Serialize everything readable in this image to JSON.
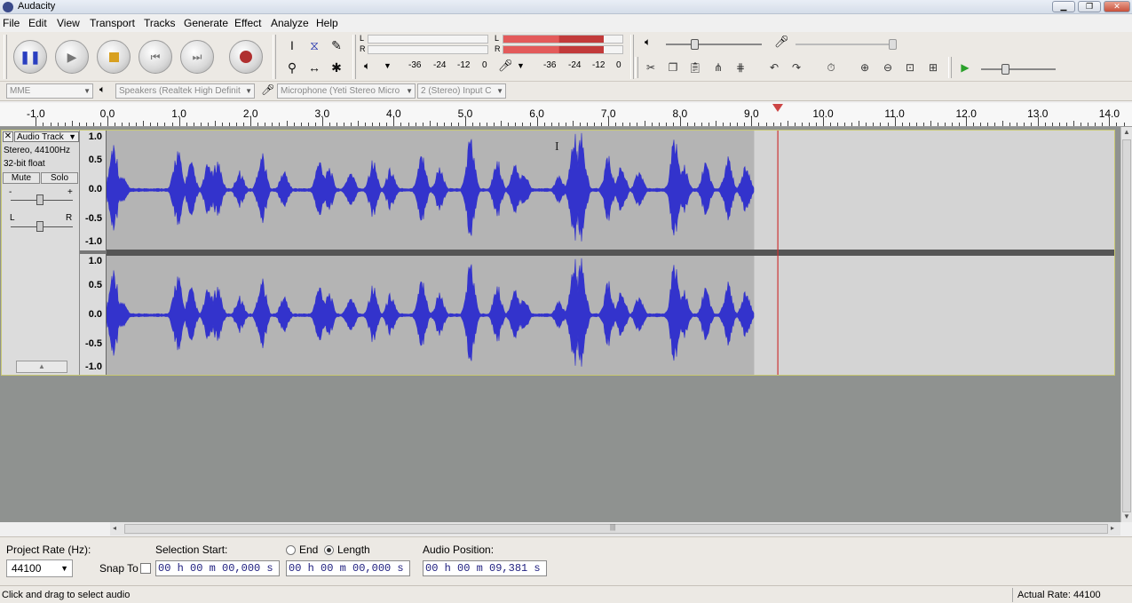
{
  "window": {
    "title": "Audacity"
  },
  "menu": [
    "File",
    "Edit",
    "View",
    "Transport",
    "Tracks",
    "Generate",
    "Effect",
    "Analyze",
    "Help"
  ],
  "meters": {
    "playback_scale": [
      "-36",
      "-24",
      "-12",
      "0"
    ],
    "record_scale": [
      "-36",
      "-24",
      "-12",
      "0"
    ],
    "channel_L": "L",
    "channel_R": "R"
  },
  "device": {
    "host": "MME",
    "speakers": "Speakers (Realtek High Definit",
    "microphone": "Microphone (Yeti Stereo Micro",
    "channels": "2 (Stereo) Input C"
  },
  "ruler": {
    "ticks": [
      "-1.0",
      "0.0",
      "1.0",
      "2.0",
      "3.0",
      "4.0",
      "5.0",
      "6.0",
      "7.0",
      "8.0",
      "9.0",
      "10.0",
      "11.0",
      "12.0",
      "13.0",
      "14.0"
    ]
  },
  "track": {
    "name": "Audio Track",
    "info_line1": "Stereo, 44100Hz",
    "info_line2": "32-bit float",
    "mute": "Mute",
    "solo": "Solo",
    "gain_minus": "-",
    "gain_plus": "+",
    "pan_left": "L",
    "pan_right": "R",
    "scale": [
      "1.0",
      "0.5",
      "0.0",
      "-0.5",
      "-1.0"
    ],
    "clip_end_seconds": 9.05,
    "cursor_seconds": 9.381
  },
  "selection": {
    "project_rate_label": "Project Rate (Hz):",
    "project_rate": "44100",
    "snap_to": "Snap To",
    "selection_start_label": "Selection Start:",
    "end_label": "End",
    "length_label": "Length",
    "audio_position_label": "Audio Position:",
    "start_value": "00 h 00 m 00,000 s",
    "length_value": "00 h 00 m 00,000 s",
    "position_value": "00 h 00 m 09,381 s"
  },
  "status": {
    "message": "Click and drag to select audio",
    "actual_rate": "Actual Rate: 44100"
  },
  "colors": {
    "waveform": "#3333cc",
    "clip_bg": "#b4b4b4",
    "track_border": "#c8c872",
    "record_meter": "#e05050",
    "cursor": "#cc3333"
  }
}
